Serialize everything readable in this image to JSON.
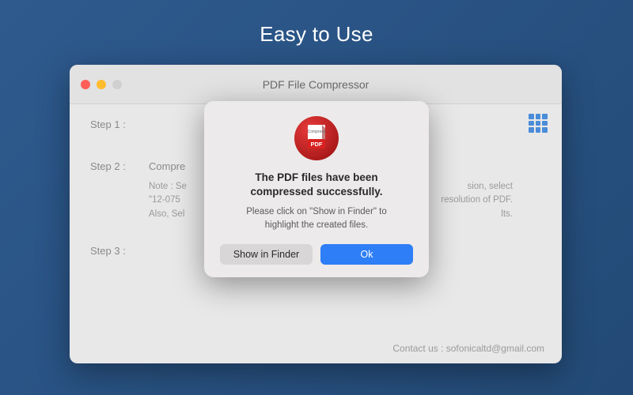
{
  "headline": "Easy to Use",
  "window": {
    "title": "PDF File Compressor",
    "steps": {
      "step1_label": "Step 1 :",
      "step2_label": "Step 2 :",
      "step2_title": "Compre",
      "step2_note_line1": "Note : Se",
      "step2_note_line1_end": "sion, select",
      "step2_note_line2": "\"12-075",
      "step2_note_line2_end": "resolution of PDF.",
      "step2_note_line3": "Also, Sel",
      "step2_note_line3_end": "lts.",
      "step3_label": "Step 3 :"
    },
    "contact": "Contact us : sofonicaltd@gmail.com"
  },
  "dialog": {
    "title_line1": "The PDF files have been",
    "title_line2": "compressed successfully.",
    "message_line1": "Please click on \"Show in Finder\" to",
    "message_line2": "highlight the created files.",
    "secondary_button": "Show in Finder",
    "primary_button": "Ok",
    "icon_label_top": "Compress",
    "icon_label_bottom": "PDF"
  }
}
